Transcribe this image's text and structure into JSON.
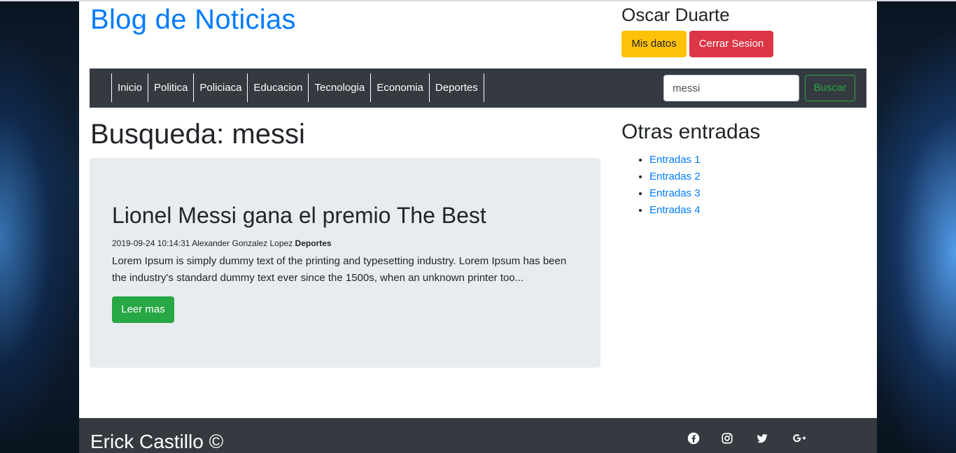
{
  "header": {
    "brand": "Blog de Noticias",
    "user_name": "Oscar Duarte",
    "my_data_label": "Mis datos",
    "logout_label": "Cerrar Sesion"
  },
  "nav": {
    "items": [
      "Inicio",
      "Politica",
      "Policiaca",
      "Educacion",
      "Tecnologia",
      "Economia",
      "Deportes"
    ],
    "search_value": "messi",
    "search_button": "Buscar"
  },
  "main": {
    "search_title": "Busqueda: messi",
    "post": {
      "title": "Lionel Messi gana el premio The Best",
      "datetime": "2019-09-24 10:14:31",
      "author": "Alexander Gonzalez Lopez",
      "category": "Deportes",
      "excerpt": "Lorem Ipsum is simply dummy text of the printing and typesetting industry. Lorem Ipsum has been the industry's standard dummy text ever since the 1500s, when an unknown printer too...",
      "read_more": "Leer mas"
    }
  },
  "sidebar": {
    "title": "Otras entradas",
    "links": [
      "Entradas 1",
      "Entradas 2",
      "Entradas 3",
      "Entradas 4"
    ]
  },
  "footer": {
    "text": "Erick Castillo ©",
    "social_icons": [
      "facebook-icon",
      "instagram-icon",
      "twitter-icon",
      "google-plus-icon"
    ]
  },
  "colors": {
    "primary": "#007bff",
    "warning": "#ffc107",
    "danger": "#dc3545",
    "success": "#28a745",
    "dark": "#343a40",
    "jumbotron": "#e9ecef"
  }
}
